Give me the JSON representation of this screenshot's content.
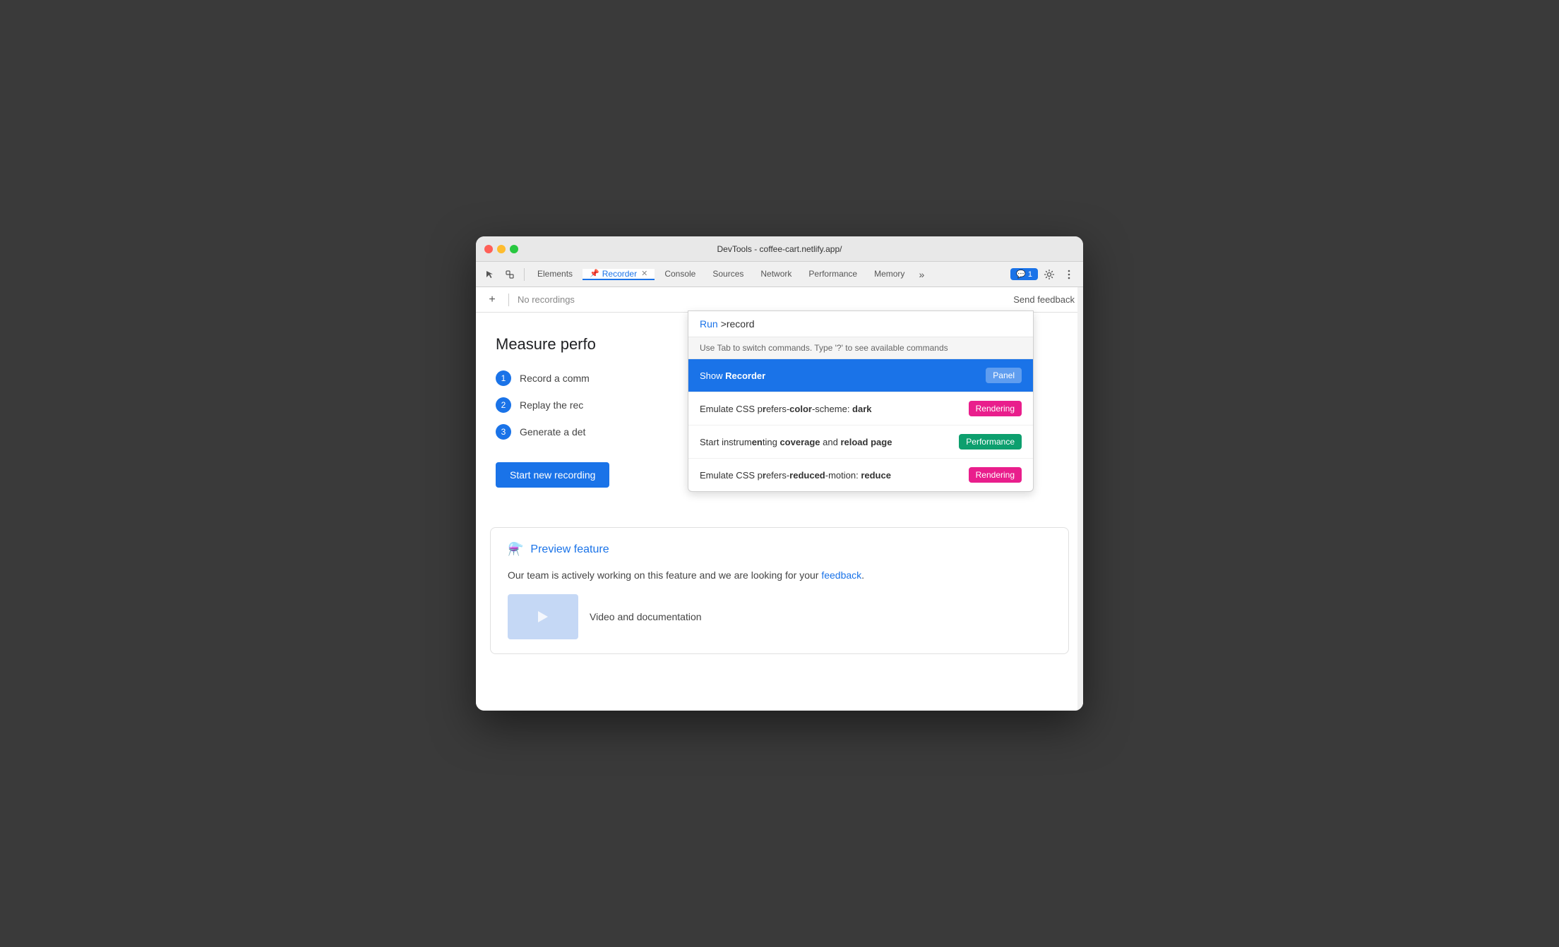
{
  "window": {
    "title": "DevTools - coffee-cart.netlify.app/"
  },
  "tabs": {
    "items": [
      {
        "id": "elements",
        "label": "Elements",
        "active": false
      },
      {
        "id": "recorder",
        "label": "Recorder",
        "active": true,
        "hasPin": true,
        "hasClose": true
      },
      {
        "id": "console",
        "label": "Console",
        "active": false
      },
      {
        "id": "sources",
        "label": "Sources",
        "active": false
      },
      {
        "id": "network",
        "label": "Network",
        "active": false
      },
      {
        "id": "performance",
        "label": "Performance",
        "active": false
      },
      {
        "id": "memory",
        "label": "Memory",
        "active": false
      }
    ],
    "more_label": "»",
    "feedback_count": "1"
  },
  "recorder": {
    "add_button": "+",
    "no_recordings": "No recordings",
    "send_feedback": "Send feedback",
    "measure_title": "Measure perfo",
    "steps": [
      {
        "num": "1",
        "text": "Record a comm"
      },
      {
        "num": "2",
        "text": "Replay the rec"
      },
      {
        "num": "3",
        "text": "Generate a det"
      }
    ],
    "start_button": "Start new recording",
    "preview_title": "Preview feature",
    "preview_desc_before": "Our team is actively working on this feature and we are looking for your ",
    "preview_link": "feedback",
    "preview_desc_after": ".",
    "video_doc_label": "Video and documentation"
  },
  "command_palette": {
    "run_label": "Run",
    "input_value": ">record",
    "hint": "Use Tab to switch commands. Type '?' to see available commands",
    "items": [
      {
        "id": "show-recorder",
        "text_before": "Show ",
        "text_em": "Recorder",
        "text_after": "",
        "highlighted": true,
        "badge": "Panel",
        "badge_class": "badge-panel"
      },
      {
        "id": "emulate-dark",
        "text_before": "Emulate CSS p",
        "text_em": "r",
        "text_middle": "efers-",
        "text_em2": "color",
        "text_after": "-scheme: dark",
        "highlighted": false,
        "badge": "Rendering",
        "badge_class": "badge-rendering"
      },
      {
        "id": "start-coverage",
        "text_before": "Start instrum",
        "text_em": "en",
        "text_after": "ting coverage and reload page",
        "highlighted": false,
        "badge": "Performance",
        "badge_class": "badge-performance"
      },
      {
        "id": "emulate-motion",
        "text_before": "Emulate CSS p",
        "text_em": "r",
        "text_middle": "efers-",
        "text_em2": "reduced",
        "text_after": "-motion: reduce",
        "highlighted": false,
        "badge": "Rendering",
        "badge_class": "badge-rendering"
      }
    ]
  }
}
